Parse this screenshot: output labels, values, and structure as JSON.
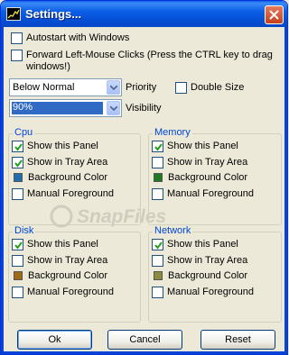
{
  "window": {
    "title": "Settings...",
    "title_icon": "chart-icon",
    "close_icon": "close-icon"
  },
  "general": {
    "autostart": {
      "label": "Autostart with Windows",
      "checked": false
    },
    "forward_clicks": {
      "label": "Forward Left-Mouse Clicks (Press the CTRL key to drag windows!)",
      "checked": false
    },
    "priority": {
      "value": "Below Normal",
      "label": "Priority"
    },
    "double_size": {
      "label": "Double Size",
      "checked": false
    },
    "visibility": {
      "value": "90%",
      "label": "Visibility"
    }
  },
  "groups": [
    {
      "title": "Cpu",
      "show_panel": "Show this Panel",
      "show_tray": "Show in Tray Area",
      "bg_color_label": "Background Color",
      "bg_color": "#1f6fb0",
      "manual_fg": "Manual Foreground",
      "panel_checked": true,
      "tray_checked": true,
      "fg_checked": false
    },
    {
      "title": "Memory",
      "show_panel": "Show this Panel",
      "show_tray": "Show in Tray Area",
      "bg_color_label": "Background Color",
      "bg_color": "#1e7a1e",
      "manual_fg": "Manual Foreground",
      "panel_checked": true,
      "tray_checked": false,
      "fg_checked": false
    },
    {
      "title": "Disk",
      "show_panel": "Show this Panel",
      "show_tray": "Show in Tray Area",
      "bg_color_label": "Background Color",
      "bg_color": "#a06a1c",
      "manual_fg": "Manual Foreground",
      "panel_checked": true,
      "tray_checked": false,
      "fg_checked": false
    },
    {
      "title": "Network",
      "show_panel": "Show this Panel",
      "show_tray": "Show in Tray Area",
      "bg_color_label": "Background Color",
      "bg_color": "#8e8a3c",
      "manual_fg": "Manual Foreground",
      "panel_checked": true,
      "tray_checked": false,
      "fg_checked": false
    }
  ],
  "buttons": {
    "ok": "Ok",
    "cancel": "Cancel",
    "reset": "Reset"
  },
  "watermark": {
    "text": "SnapFiles"
  }
}
